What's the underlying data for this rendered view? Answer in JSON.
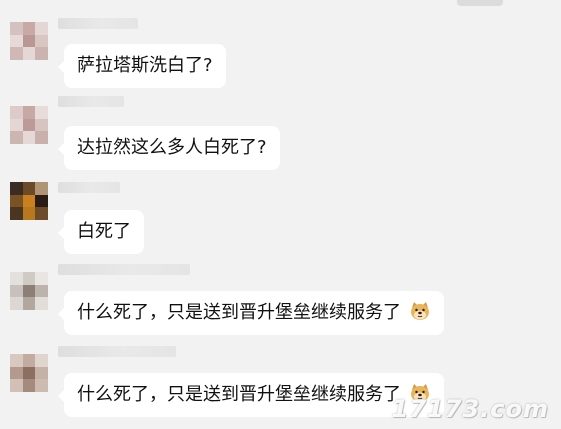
{
  "messages": [
    {
      "text": "萨拉塔斯洗白了?",
      "emoji": ""
    },
    {
      "text": "达拉然这么多人白死了?",
      "emoji": ""
    },
    {
      "text": "白死了",
      "emoji": ""
    },
    {
      "text": "什么死了，只是送到晋升堡垒继续服务了",
      "emoji": "doge-emoji"
    },
    {
      "text": "什么死了，只是送到晋升堡垒继续服务了",
      "emoji": "doge-emoji"
    }
  ],
  "watermark": "17173.com",
  "colors": {
    "background": "#f2f2f2",
    "bubble": "#ffffff",
    "text": "#111111"
  }
}
